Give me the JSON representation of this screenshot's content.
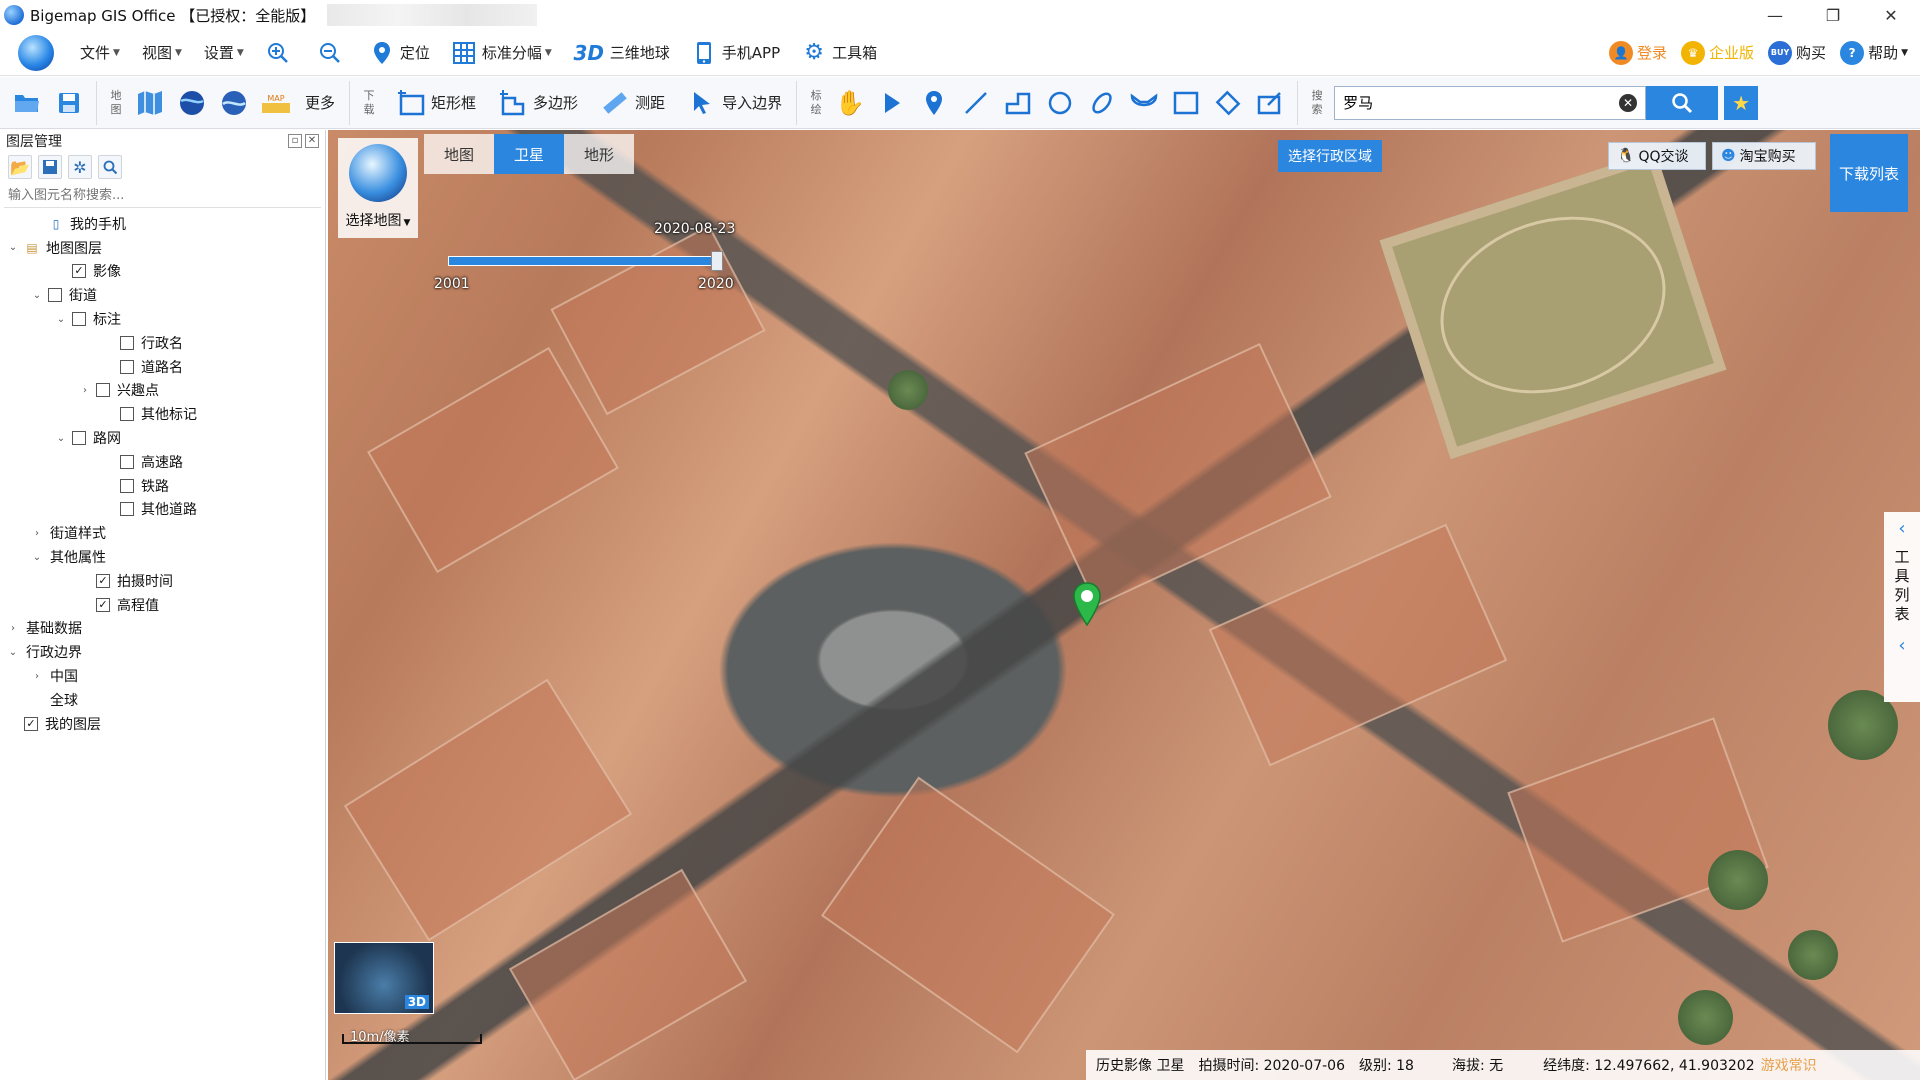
{
  "window": {
    "title": "Bigemap GIS Office 【已授权：全能版】",
    "controls": [
      "—",
      "❐",
      "✕"
    ]
  },
  "menu": {
    "items": [
      {
        "label": "文件",
        "caret": true
      },
      {
        "label": "视图",
        "caret": true
      },
      {
        "label": "设置",
        "caret": true
      }
    ],
    "tools": [
      {
        "label": "",
        "icon": "zoom-in-icon"
      },
      {
        "label": "",
        "icon": "zoom-out-icon"
      },
      {
        "label": "定位",
        "icon": "location-pin-icon"
      },
      {
        "label": "标准分幅",
        "icon": "grid-icon",
        "caret": true
      },
      {
        "label": "三维地球",
        "icon": "3d-icon",
        "prefix": "3D"
      },
      {
        "label": "手机APP",
        "icon": "phone-icon"
      },
      {
        "label": "工具箱",
        "icon": "gear-icon"
      }
    ],
    "right": [
      {
        "label": "登录",
        "color": "#f08a24"
      },
      {
        "label": "企业版",
        "color": "#f2b400"
      },
      {
        "label": "购买",
        "color": "#2b6fd6",
        "badge": "BUY"
      },
      {
        "label": "帮助",
        "color": "#2b86e0",
        "badge": "?",
        "caret": true
      }
    ]
  },
  "toolbar": {
    "map_label": "地图",
    "more": "更多",
    "download_label": "下载",
    "rect": "矩形框",
    "polygon": "多边形",
    "measure": "测距",
    "import_boundary": "导入边界",
    "mark_label": "标绘",
    "search_label": "搜索",
    "search_value": "罗马"
  },
  "layers": {
    "title": "图层管理",
    "search_placeholder": "输入图元名称搜索...",
    "tree": [
      {
        "label": "我的手机",
        "level": 1,
        "toggle": "",
        "checkbox": null,
        "icon": "phone"
      },
      {
        "label": "地图图层",
        "level": 0,
        "toggle": "v",
        "checkbox": null,
        "icon": "folder"
      },
      {
        "label": "影像",
        "level": 2,
        "toggle": "",
        "checkbox": true
      },
      {
        "label": "街道",
        "level": 1,
        "toggle": "v",
        "checkbox": false
      },
      {
        "label": "标注",
        "level": 2,
        "toggle": "v",
        "checkbox": false
      },
      {
        "label": "行政名",
        "level": 4,
        "toggle": "",
        "checkbox": false
      },
      {
        "label": "道路名",
        "level": 4,
        "toggle": "",
        "checkbox": false
      },
      {
        "label": "兴趣点",
        "level": 3,
        "toggle": ">",
        "checkbox": false
      },
      {
        "label": "其他标记",
        "level": 4,
        "toggle": "",
        "checkbox": false
      },
      {
        "label": "路网",
        "level": 2,
        "toggle": "v",
        "checkbox": false
      },
      {
        "label": "高速路",
        "level": 4,
        "toggle": "",
        "checkbox": false
      },
      {
        "label": "铁路",
        "level": 4,
        "toggle": "",
        "checkbox": false
      },
      {
        "label": "其他道路",
        "level": 4,
        "toggle": "",
        "checkbox": false
      },
      {
        "label": "街道样式",
        "level": 1,
        "toggle": ">",
        "checkbox": null
      },
      {
        "label": "其他属性",
        "level": 1,
        "toggle": "v",
        "checkbox": null
      },
      {
        "label": "拍摄时间",
        "level": 3,
        "toggle": "",
        "checkbox": true
      },
      {
        "label": "高程值",
        "level": 3,
        "toggle": "",
        "checkbox": true
      },
      {
        "label": "基础数据",
        "level": 0,
        "toggle": ">",
        "checkbox": null
      },
      {
        "label": "行政边界",
        "level": 0,
        "toggle": "v",
        "checkbox": null
      },
      {
        "label": "中国",
        "level": 1,
        "toggle": ">",
        "checkbox": null
      },
      {
        "label": "全球",
        "level": 1,
        "toggle": "",
        "checkbox": null
      },
      {
        "label": "我的图层",
        "level": 0,
        "toggle": "",
        "checkbox": true
      }
    ]
  },
  "map": {
    "select_map": "选择地图",
    "tabs": [
      "地图",
      "卫星",
      "地形"
    ],
    "active_tab": "卫星",
    "timeline": {
      "date": "2020-08-23",
      "start": "2001",
      "end": "2020"
    },
    "select_region": "选择行政区域",
    "qq": "QQ交谈",
    "taobao": "淘宝购买",
    "download_list": "下载列表",
    "side_tools": "工具列表",
    "minimap_label": "3D",
    "scale_text": "10m/像素"
  },
  "status": {
    "history": "历史影像 卫星",
    "capture_time": "拍摄时间: 2020-07-06",
    "level": "级别: 18",
    "altitude": "海拔: 无",
    "coords": "经纬度:  12.497662, 41.903202",
    "game": "游戏常识"
  },
  "colors": {
    "accent": "#2b86e0",
    "pin": "#2db84a"
  }
}
